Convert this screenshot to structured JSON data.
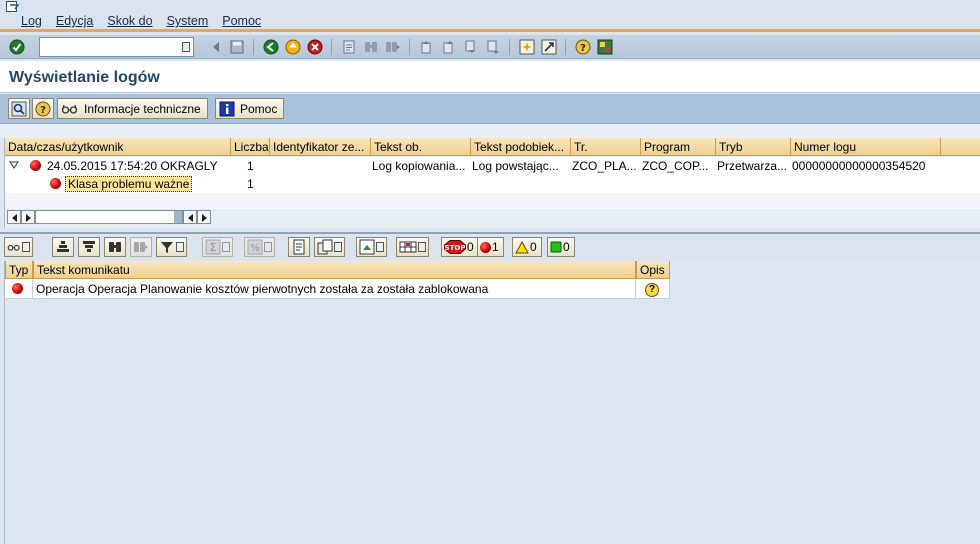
{
  "menu": {
    "items": [
      "Log",
      "Edycja",
      "Skok do",
      "System",
      "Pomoc"
    ]
  },
  "command_field": {
    "value": ""
  },
  "title": "Wyświetlanie logów",
  "app_toolbar": {
    "tech_info_label": "Informacje techniczne",
    "help_label": "Pomoc"
  },
  "log_grid": {
    "columns": [
      "Data/czas/użytkownik",
      "Liczba",
      "Identyfikator ze...",
      "Tekst ob.",
      "Tekst podobiek...",
      "Tr.",
      "Program",
      "Tryb",
      "Numer logu"
    ],
    "row": {
      "datetime": "24.05.2015  17:54:20  OKRAGLY",
      "count": "1",
      "object_text": "Log kopiowania...",
      "subobject_text": "Log powstając...",
      "transaction": "ZCO_PLA...",
      "program": "ZCO_COP...",
      "mode": "Przetwarza...",
      "log_number": "00000000000000354520"
    },
    "child": {
      "label": "Klasa problemu ważne",
      "count": "1"
    }
  },
  "message_toolbar": {
    "stop_count": "0",
    "error_count": "1",
    "warning_count": "0",
    "success_count": "0"
  },
  "message_grid": {
    "columns": [
      "Typ",
      "Tekst komunikatu",
      "Opis"
    ],
    "rows": [
      {
        "text": "Operacja Operacja Planowanie kosztów pierwotnych została za została zablokowana"
      }
    ]
  },
  "colors": {
    "accent_orange": "#f0a63c",
    "title_blue": "#23476e",
    "header_gold": "#efcf8e"
  }
}
